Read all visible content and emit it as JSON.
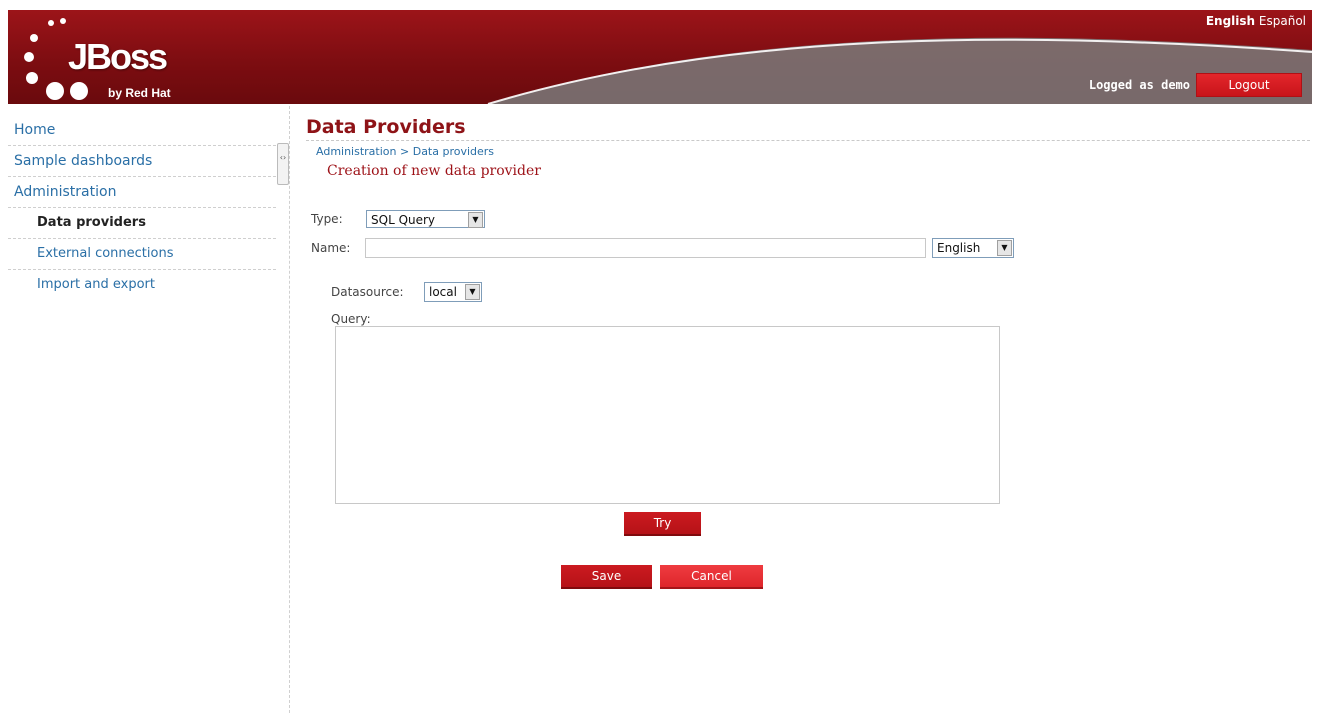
{
  "header": {
    "brand_main": "JBoss",
    "brand_sub": "by Red Hat",
    "languages": [
      {
        "label": "English",
        "active": true
      },
      {
        "label": "Español",
        "active": false
      }
    ],
    "logged_text": "Logged as demo",
    "logout_label": "Logout"
  },
  "sidebar": {
    "items": [
      {
        "label": "Home"
      },
      {
        "label": "Sample dashboards"
      },
      {
        "label": "Administration"
      }
    ],
    "subitems": [
      {
        "label": "Data providers",
        "selected": true
      },
      {
        "label": "External connections"
      },
      {
        "label": "Import and export"
      }
    ]
  },
  "main": {
    "title": "Data Providers",
    "breadcrumb": [
      "Administration",
      "Data providers"
    ],
    "breadcrumb_sep": ">",
    "subtitle": "Creation of new data provider",
    "type_label": "Type:",
    "type_value": "SQL Query",
    "name_label": "Name:",
    "name_value": "",
    "name_lang_value": "English",
    "datasource_label": "Datasource:",
    "datasource_value": "local",
    "query_label": "Query:",
    "query_value": "",
    "try_label": "Try",
    "save_label": "Save",
    "cancel_label": "Cancel"
  },
  "colors": {
    "brand_red": "#9c1419",
    "link_blue": "#2a6fa6",
    "title_red": "#8e1317"
  }
}
